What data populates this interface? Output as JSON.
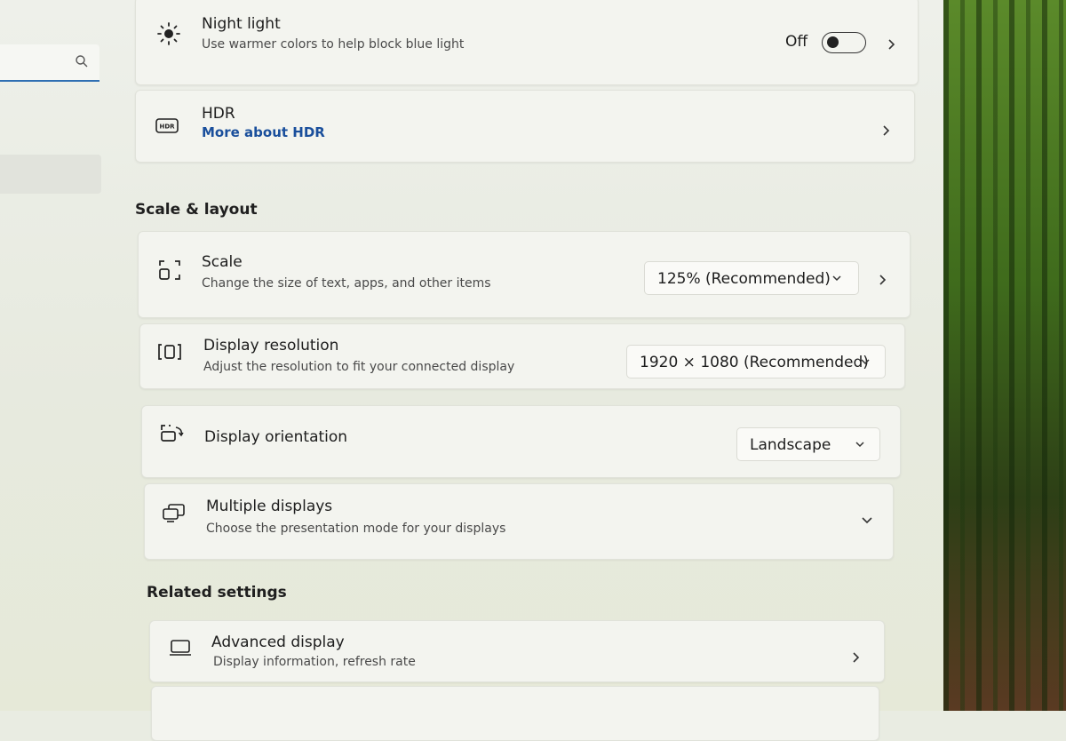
{
  "search": {
    "placeholder": ""
  },
  "night_light": {
    "title": "Night light",
    "subtitle": "Use warmer colors to help block blue light",
    "state": "Off"
  },
  "hdr": {
    "title": "HDR",
    "link": "More about HDR"
  },
  "scale_layout": {
    "heading": "Scale & layout",
    "scale": {
      "title": "Scale",
      "subtitle": "Change the size of text, apps, and other items",
      "value": "125% (Recommended)"
    },
    "resolution": {
      "title": "Display resolution",
      "subtitle": "Adjust the resolution to fit your connected display",
      "value": "1920 × 1080 (Recommended)"
    },
    "orientation": {
      "title": "Display orientation",
      "value": "Landscape"
    },
    "multiple": {
      "title": "Multiple displays",
      "subtitle": "Choose the presentation mode for your displays"
    }
  },
  "related": {
    "heading": "Related settings",
    "advanced": {
      "title": "Advanced display",
      "subtitle": "Display information, refresh rate"
    }
  },
  "colors": {
    "accent": "#2f6fb3",
    "link": "#1a4f9c"
  }
}
